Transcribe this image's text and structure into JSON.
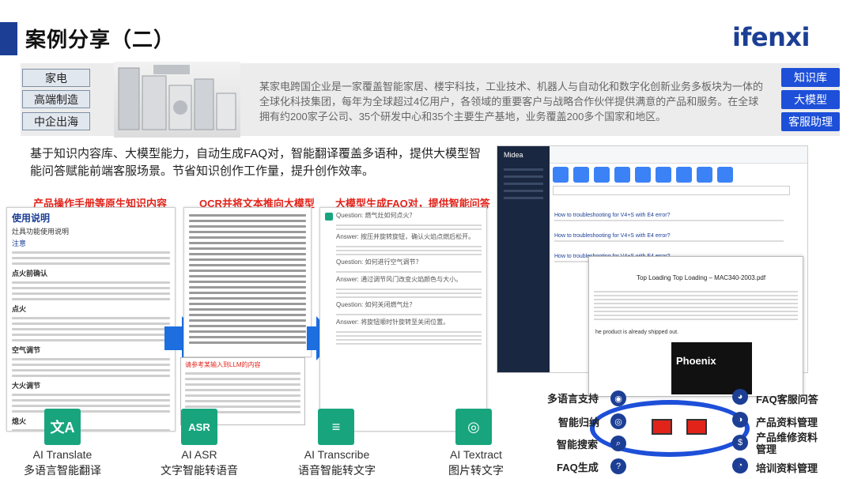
{
  "header": {
    "title": "案例分享（二）",
    "logo": "ifenxi"
  },
  "tags": [
    "家电",
    "高端制造",
    "中企出海"
  ],
  "description": "某家电跨国企业是一家覆盖智能家居、楼宇科技，工业技术、机器人与自动化和数字化创新业务多板块为一体的全球化科技集团，每年为全球超过4亿用户，各领域的重要客户与战略合作伙伴提供满意的产品和服务。在全球拥有约200家子公司、35个研发中心和35个主要生产基地，业务覆盖200多个国家和地区。",
  "side_buttons": [
    "知识库",
    "大模型",
    "客服助理"
  ],
  "summary": "基于知识内容库、大模型能力，自动生成FAQ对，智能翻译覆盖多语种，提供大模型智能问答赋能前端客服场景。节省知识创作工作量，提升创作效率。",
  "columns": [
    "产品操作手册等原生知识内容",
    "OCR并将文本推向大模型",
    "大模型生成FAQ对，提供智能问答"
  ],
  "doc1": {
    "title": "使用说明",
    "subtitle": "灶具功能使用说明",
    "sections": [
      "注意",
      "点火前确认",
      "点火",
      "空气调节",
      "大火调节",
      "熄火"
    ]
  },
  "inset": {
    "title": "请参考某输入到LLM的内容"
  },
  "doc3": {
    "qa": [
      "Question: 燃气灶如何点火？",
      "Answer: 按压并旋转旋钮，确认火焰点燃后松开。",
      "Question: 如何进行空气调节？",
      "Answer: 通过调节风门改变火焰颜色与大小。",
      "Question: 如何关闭燃气灶？",
      "Answer: 将旋钮顺时针旋转至关闭位置。"
    ]
  },
  "tools": [
    {
      "icon": "translate-icon",
      "glyph": "文A",
      "name": "AI Translate",
      "sub": "多语言智能翻译"
    },
    {
      "icon": "asr-icon",
      "glyph": "ASR",
      "name": "AI ASR",
      "sub": "文字智能转语音"
    },
    {
      "icon": "transcribe-icon",
      "glyph": "≡",
      "name": "AI Transcribe",
      "sub": "语音智能转文字"
    },
    {
      "icon": "ocr-icon",
      "glyph": "◎",
      "name": "AI Textract",
      "sub": "图片转文字"
    }
  ],
  "screenshot": {
    "brand": "Midea",
    "items": [
      "How to troubleshooting for V4+S with E4 error?",
      "How to troubleshooting for V4+S with E4 error?",
      "How to troubleshooting for V4+S with E4 error?"
    ],
    "doc_title": "Top Loading Top Loading – MAC340-2003.pdf",
    "product": "Phoenix",
    "shipped_note": "he product is already shipped out."
  },
  "features_left": [
    "多语言支持",
    "智能归纳",
    "智能搜索",
    "FAQ生成"
  ],
  "features_right": [
    "FAQ客服问答",
    "产品资料管理",
    "产品维修资料管理",
    "培训资料管理"
  ],
  "colors": {
    "brand": "#1c3f95",
    "accent": "#1d4fd8",
    "highlight": "#e2231a",
    "tool": "#18a57e"
  }
}
